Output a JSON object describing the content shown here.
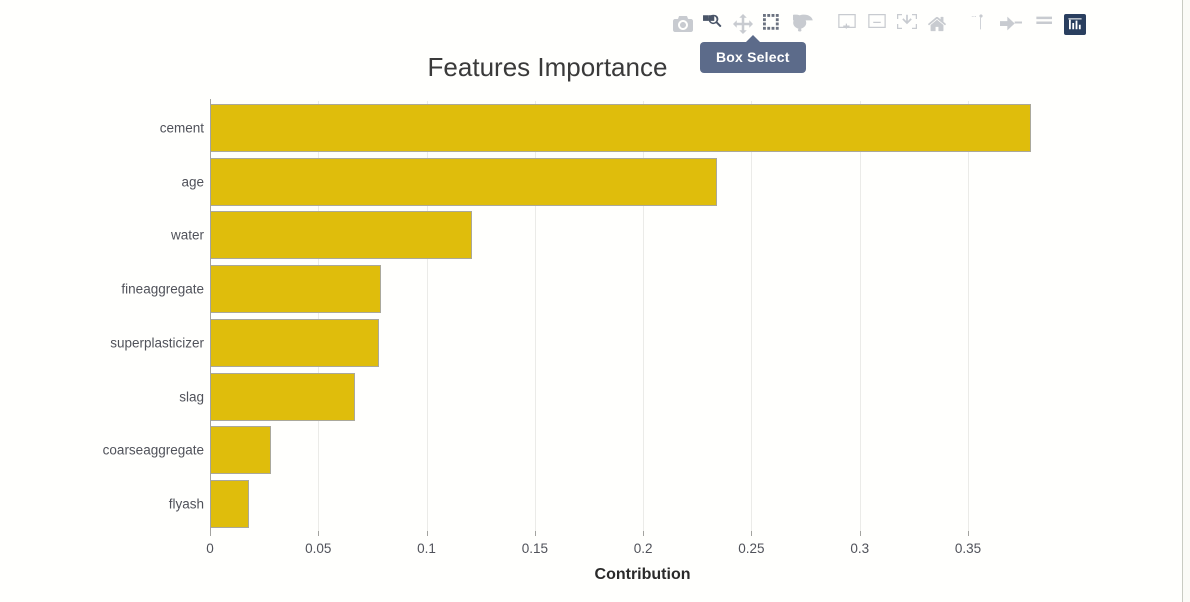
{
  "chart_data": {
    "type": "bar",
    "orientation": "horizontal",
    "title": "Features Importance",
    "xlabel": "Contribution",
    "ylabel": "",
    "categories": [
      "cement",
      "age",
      "water",
      "fineaggregate",
      "superplasticizer",
      "slag",
      "coarseaggregate",
      "flyash"
    ],
    "values": [
      0.379,
      0.234,
      0.121,
      0.079,
      0.078,
      0.067,
      0.028,
      0.018
    ],
    "series": [
      {
        "name": "Contribution",
        "values": [
          0.379,
          0.234,
          0.121,
          0.079,
          0.078,
          0.067,
          0.028,
          0.018
        ]
      }
    ],
    "xticks": [
      "0",
      "0.05",
      "0.1",
      "0.15",
      "0.2",
      "0.25",
      "0.3",
      "0.35"
    ],
    "xtick_values": [
      0,
      0.05,
      0.1,
      0.15,
      0.2,
      0.25,
      0.3,
      0.35
    ],
    "xlim": [
      0,
      0.403
    ],
    "grid": "vertical",
    "legend": "none",
    "bar_color": "#dfbd0c",
    "bar_border_color": "#aaa89b",
    "gridline_color": "#ebebe8",
    "axis_color": "#a3a3a0",
    "tick_font_color": "#50525a",
    "plot_background": "#fffffd"
  },
  "modebar": {
    "tooltip": "Box Select",
    "accent_color": "#2a3f5f",
    "tooltip_background": "#5c6b8a",
    "buttons": [
      {
        "name": "camera-icon",
        "label": "Download plot as a png",
        "state": "inactive"
      },
      {
        "name": "zoom-icon",
        "label": "Zoom",
        "state": "hover"
      },
      {
        "name": "pan-icon",
        "label": "Pan",
        "state": "inactive"
      },
      {
        "name": "box-select-icon",
        "label": "Box Select",
        "state": "active"
      },
      {
        "name": "lasso-select-icon",
        "label": "Lasso Select",
        "state": "inactive"
      },
      {
        "name": "zoom-in-icon",
        "label": "Zoom in",
        "state": "inactive"
      },
      {
        "name": "zoom-out-icon",
        "label": "Zoom out",
        "state": "inactive"
      },
      {
        "name": "autoscale-icon",
        "label": "Autoscale",
        "state": "inactive"
      },
      {
        "name": "home-icon",
        "label": "Reset axes",
        "state": "inactive"
      },
      {
        "name": "spike-lines-icon",
        "label": "Toggle Spike Lines",
        "state": "inactive"
      },
      {
        "name": "hover-closest-icon",
        "label": "Show closest data on hover",
        "state": "inactive"
      },
      {
        "name": "hover-compare-icon",
        "label": "Compare data on hover",
        "state": "inactive"
      },
      {
        "name": "plotly-logo-icon",
        "label": "Produced with Plotly",
        "state": "highlighted"
      }
    ]
  }
}
